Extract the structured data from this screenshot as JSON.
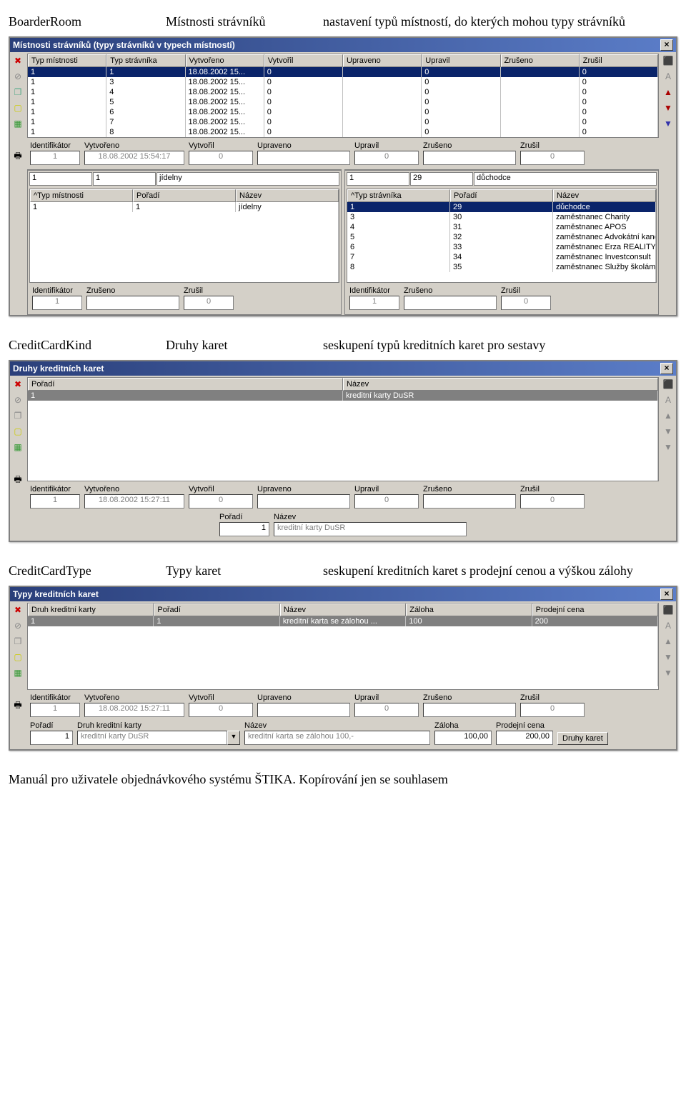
{
  "section1": {
    "code": "BoarderRoom",
    "name": "Místnosti strávníků",
    "desc": "nastavení typů místností, do kterých mohou typy strávníků"
  },
  "win1": {
    "title": "Místnosti strávníků (typy strávníků v typech místností)",
    "grid_headers": [
      "Typ místnosti",
      "Typ strávníka",
      "Vytvořeno",
      "Vytvořil",
      "Upraveno",
      "Upravil",
      "Zrušeno",
      "Zrušil"
    ],
    "rows": [
      [
        "1",
        "1",
        "18.08.2002 15...",
        "0",
        "",
        "0",
        "",
        "0"
      ],
      [
        "1",
        "3",
        "18.08.2002 15...",
        "0",
        "",
        "0",
        "",
        "0"
      ],
      [
        "1",
        "4",
        "18.08.2002 15...",
        "0",
        "",
        "0",
        "",
        "0"
      ],
      [
        "1",
        "5",
        "18.08.2002 15...",
        "0",
        "",
        "0",
        "",
        "0"
      ],
      [
        "1",
        "6",
        "18.08.2002 15...",
        "0",
        "",
        "0",
        "",
        "0"
      ],
      [
        "1",
        "7",
        "18.08.2002 15...",
        "0",
        "",
        "0",
        "",
        "0"
      ],
      [
        "1",
        "8",
        "18.08.2002 15...",
        "0",
        "",
        "0",
        "",
        "0"
      ]
    ],
    "fields": {
      "labels": [
        "Identifikátor",
        "Vytvořeno",
        "Vytvořil",
        "Upraveno",
        "Upravil",
        "Zrušeno",
        "Zrušil"
      ],
      "values": [
        "1",
        "18.08.2002 15:54:17",
        "0",
        "",
        "0",
        "",
        "0"
      ]
    },
    "left": {
      "toprow": [
        "1",
        "1",
        "jídelny"
      ],
      "headers": [
        "^Typ místnosti",
        "Pořadí",
        "Název"
      ],
      "rows": [
        [
          "1",
          "1",
          "jídelny"
        ]
      ],
      "fields": {
        "labels": [
          "Identifikátor",
          "Zrušeno",
          "Zrušil"
        ],
        "values": [
          "1",
          "",
          "0"
        ]
      }
    },
    "right": {
      "toprow": [
        "1",
        "29",
        "důchodce"
      ],
      "headers": [
        "^Typ strávníka",
        "Pořadí",
        "Název"
      ],
      "rows": [
        [
          "1",
          "29",
          "důchodce"
        ],
        [
          "3",
          "30",
          "zaměstnanec Charity"
        ],
        [
          "4",
          "31",
          "zaměstnanec APOS"
        ],
        [
          "5",
          "32",
          "zaměstnanec Advokátní kancel..."
        ],
        [
          "6",
          "33",
          "zaměstnanec Erza REALITY"
        ],
        [
          "7",
          "34",
          "zaměstnanec Investconsult"
        ],
        [
          "8",
          "35",
          "zaměstnanec Služby školám"
        ]
      ],
      "fields": {
        "labels": [
          "Identifikátor",
          "Zrušeno",
          "Zrušil"
        ],
        "values": [
          "1",
          "",
          "0"
        ]
      }
    }
  },
  "section2": {
    "code": "CreditCardKind",
    "name": "Druhy karet",
    "desc": "seskupení typů kreditních karet pro sestavy"
  },
  "win2": {
    "title": "Druhy kreditních karet",
    "grid_headers": [
      "Pořadí",
      "Název"
    ],
    "rows": [
      [
        "1",
        "kreditní karty DuSR"
      ]
    ],
    "fields": {
      "labels": [
        "Identifikátor",
        "Vytvořeno",
        "Vytvořil",
        "Upraveno",
        "Upravil",
        "Zrušeno",
        "Zrušil"
      ],
      "values": [
        "1",
        "18.08.2002 15:27:11",
        "0",
        "",
        "0",
        "",
        "0"
      ]
    },
    "edit_labels": [
      "Pořadí",
      "Název"
    ],
    "edit_values": [
      "1",
      "kreditní karty DuSR"
    ]
  },
  "section3": {
    "code": "CreditCardType",
    "name": "Typy karet",
    "desc": "seskupení kreditních karet s prodejní cenou a výškou zálohy"
  },
  "win3": {
    "title": "Typy kreditních karet",
    "grid_headers": [
      "Druh kreditní karty",
      "Pořadí",
      "Název",
      "Záloha",
      "Prodejní cena"
    ],
    "rows": [
      [
        "1",
        "1",
        "kreditní karta se zálohou ...",
        "100",
        "200"
      ]
    ],
    "fields": {
      "labels": [
        "Identifikátor",
        "Vytvořeno",
        "Vytvořil",
        "Upraveno",
        "Upravil",
        "Zrušeno",
        "Zrušil"
      ],
      "values": [
        "1",
        "18.08.2002 15:27:11",
        "0",
        "",
        "0",
        "",
        "0"
      ]
    },
    "edit_labels": [
      "Pořadí",
      "Druh kreditní karty",
      "Název",
      "Záloha",
      "Prodejní cena"
    ],
    "edit_values": [
      "1",
      "kreditní karty DuSR",
      "kreditní karta se zálohou 100,-",
      "100,00",
      "200,00"
    ],
    "button": "Druhy karet"
  },
  "footer": "Manuál pro uživatele objednávkového systému ŠTIKA. Kopírování jen se souhlasem"
}
